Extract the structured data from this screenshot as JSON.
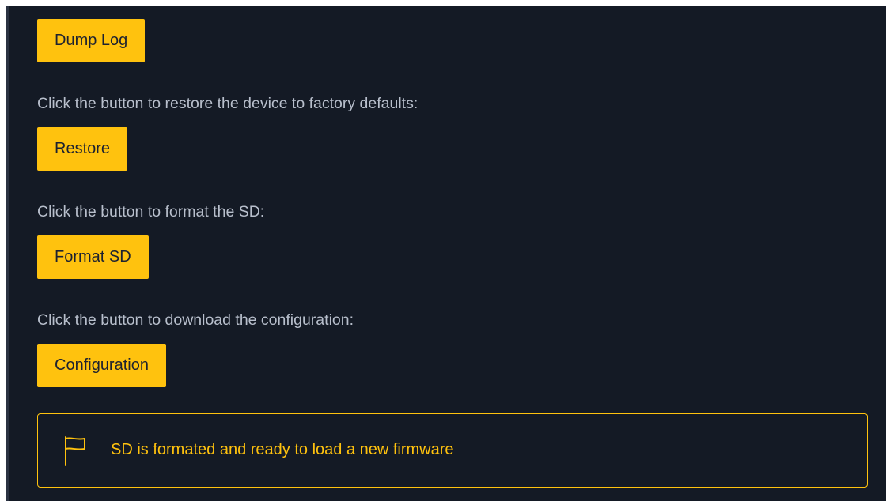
{
  "buttons": {
    "dump_log": "Dump Log",
    "restore": "Restore",
    "format_sd": "Format SD",
    "configuration": "Configuration"
  },
  "descriptions": {
    "restore": "Click the button to restore the device to factory defaults:",
    "format_sd": "Click the button to format the SD:",
    "configuration": "Click the button to download the configuration:"
  },
  "alert": {
    "message": "SD is formated and ready to load a new firmware",
    "icon": "flag-icon"
  },
  "colors": {
    "background": "#141a25",
    "accent": "#ffc20e",
    "text_muted": "#b8bfcc",
    "button_text": "#1d2230"
  }
}
